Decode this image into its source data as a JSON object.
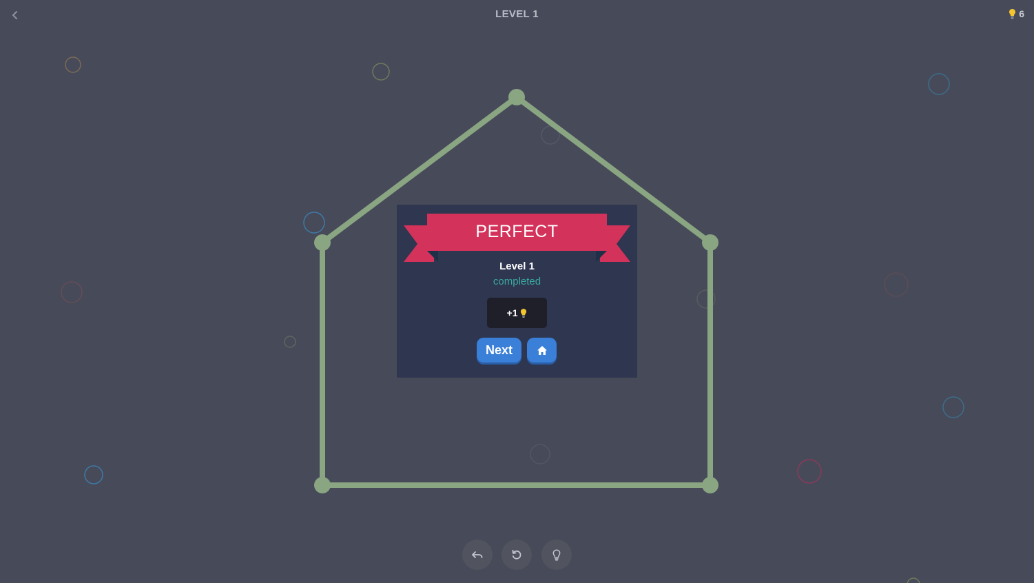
{
  "header": {
    "title": "LEVEL 1",
    "hint_count": "6",
    "back_icon": "chevron-left-icon",
    "hint_icon": "lightbulb-icon"
  },
  "dialog": {
    "banner": "PERFECT",
    "level_name": "Level 1",
    "status": "completed",
    "reward_text": "+1",
    "reward_icon": "lightbulb-icon",
    "next_label": "Next",
    "home_icon": "home-icon"
  },
  "toolbar": {
    "undo_icon": "undo-icon",
    "restart_icon": "restart-icon",
    "hint_icon": "lightbulb-icon"
  },
  "colors": {
    "background": "#474a58",
    "line": "#8aa582",
    "dialog": "#2e3650",
    "ribbon": "#d3325a",
    "button": "#3a7fd8",
    "status": "#3aa99d",
    "bulb": "#f4c531"
  }
}
